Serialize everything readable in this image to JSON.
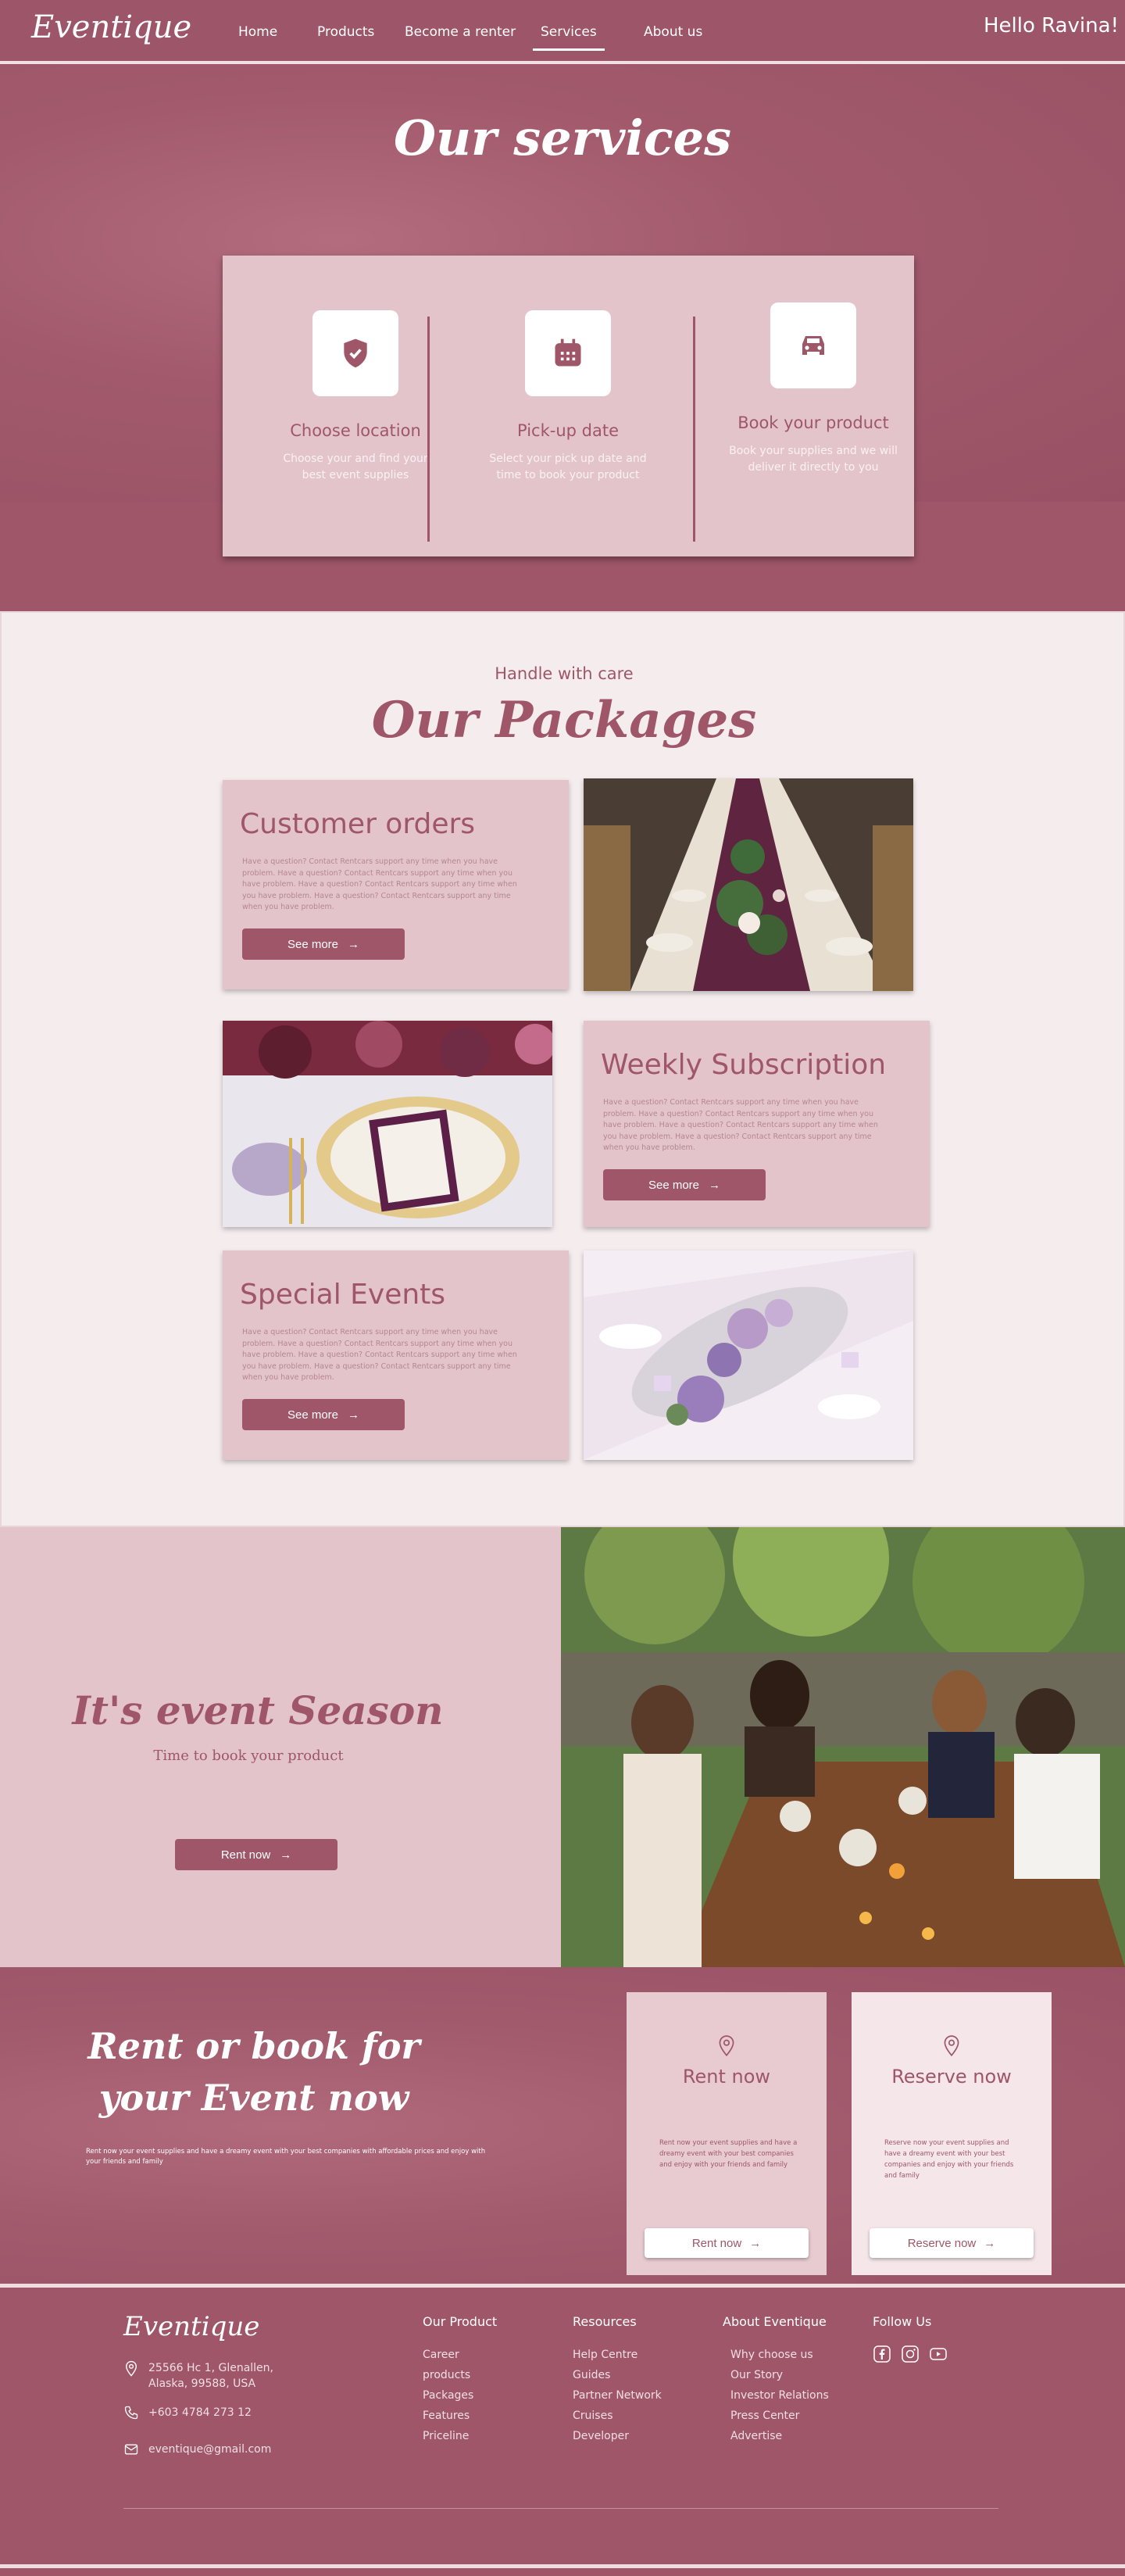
{
  "nav": {
    "logo": "Eventique",
    "links": [
      "Home",
      "Products",
      "Become a renter",
      "Services",
      "About us"
    ],
    "active": "Services",
    "greeting": "Hello Ravina!"
  },
  "services": {
    "title": "Our services",
    "items": [
      {
        "icon": "shield-check-icon",
        "title": "Choose location",
        "text": "Choose your and find your best event supplies"
      },
      {
        "icon": "calendar-icon",
        "title": "Pick-up date",
        "text": "Select your pick up date and time to book your product"
      },
      {
        "icon": "car-icon",
        "title": "Book your product",
        "text": "Book your supplies and we will deliver it directly to you"
      }
    ]
  },
  "packages": {
    "subtitle": "Handle with care",
    "title": "Our Packages",
    "lorem": "Have a question? Contact Rentcars support any time when you have problem. Have a question? Contact Rentcars support any time when you have problem. Have a question? Contact Rentcars support any time when you have problem. Have a question? Contact Rentcars support any time when you have problem.",
    "button": "See more",
    "cards": [
      {
        "title": "Customer orders"
      },
      {
        "title": "Weekly Subscription"
      },
      {
        "title": "Special Events"
      }
    ]
  },
  "season": {
    "title": "It's event Season",
    "subtitle": "Time to book  your product",
    "button": "Rent now"
  },
  "rent": {
    "title": "Rent or book for your Event now",
    "text": "Rent now your event supplies and have a dreamy event with your best companies with affordable prices and enjoy with your friends and family",
    "cards": [
      {
        "title": "Rent now",
        "text": "Rent now your event supplies and have a dreamy event with your best companies and enjoy with your friends and family",
        "button": "Rent now"
      },
      {
        "title": "Reserve now",
        "text": "Reserve now your event supplies and have a dreamy event with your best companies and enjoy with your friends and family",
        "button": "Reserve now"
      }
    ]
  },
  "footer": {
    "logo": "Eventique",
    "address": "25566 Hc 1, Glenallen, Alaska, 99588, USA",
    "phone": "+603 4784 273 12",
    "email": "eventique@gmail.com",
    "columns": [
      {
        "title": "Our Product",
        "links": [
          "Career",
          "products",
          "Packages",
          "Features",
          "Priceline"
        ]
      },
      {
        "title": "Resources",
        "links": [
          "Help Centre",
          "Guides",
          "Partner Network",
          "Cruises",
          "Developer"
        ]
      },
      {
        "title": "About Eventique",
        "links": [
          "Why choose us",
          "Our Story",
          "Investor Relations",
          "Press Center",
          "Advertise"
        ]
      },
      {
        "title": "Follow Us",
        "links": []
      }
    ],
    "social": [
      "facebook-icon",
      "instagram-icon",
      "youtube-icon"
    ]
  },
  "colors": {
    "brand": "#9e5668",
    "card": "#e4c4cb",
    "light": "#f5ecee"
  }
}
